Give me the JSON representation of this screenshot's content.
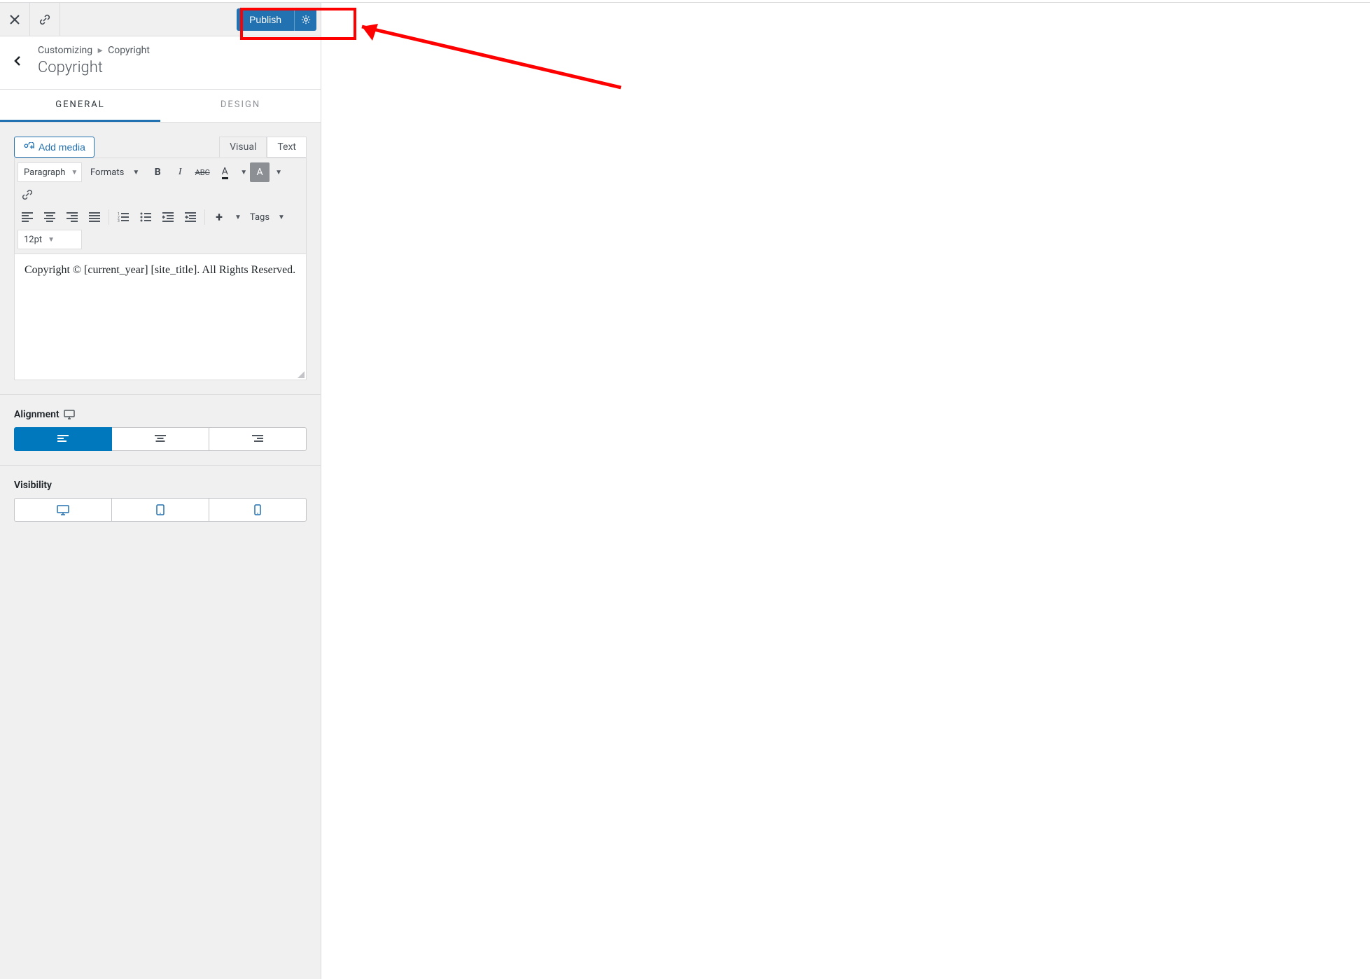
{
  "toolbar": {
    "publish_label": "Publish"
  },
  "header": {
    "breadcrumb_root": "Customizing",
    "breadcrumb_section": "Copyright",
    "panel_title": "Copyright"
  },
  "tabs": {
    "general": "General",
    "design": "Design"
  },
  "editor": {
    "add_media_label": "Add media",
    "tab_visual": "Visual",
    "tab_text": "Text",
    "block_format": "Paragraph",
    "formats_label": "Formats",
    "tags_label": "Tags",
    "font_size": "12pt",
    "content": "Copyright © [current_year] [site_title]. All Rights Reserved."
  },
  "alignment": {
    "label": "Alignment"
  },
  "visibility": {
    "label": "Visibility"
  }
}
